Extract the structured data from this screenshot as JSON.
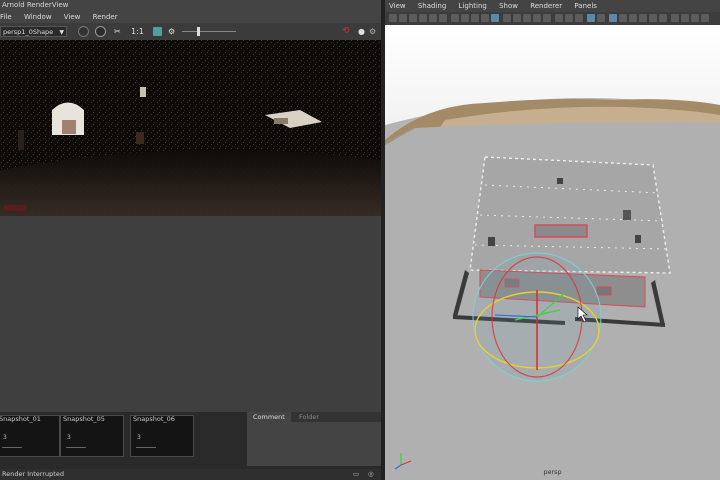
{
  "render_view": {
    "title": "Arnold RenderView",
    "menu": [
      "File",
      "Window",
      "View",
      "Render"
    ],
    "camera": "persp1_0Shape",
    "ratio_label": "1:1",
    "snapshots": [
      {
        "label": "Snapshot_01",
        "num": "3"
      },
      {
        "label": "Snapshot_05",
        "num": "3"
      },
      {
        "label": "Snapshot_06",
        "num": "3"
      }
    ],
    "comment_tabs": [
      "Comment",
      "Folder"
    ],
    "status": "Render Interrupted"
  },
  "viewport": {
    "menu": [
      "View",
      "Shading",
      "Lighting",
      "Show",
      "Renderer",
      "Panels"
    ],
    "camera_label": "persp"
  },
  "colors": {
    "accent": "#5d88a8",
    "stop": "#d03030",
    "selection": "#d94a5a",
    "manip_x": "#e03030",
    "manip_y": "#40d040",
    "manip_z": "#3070e0",
    "manip_ring": "#e8d030"
  }
}
